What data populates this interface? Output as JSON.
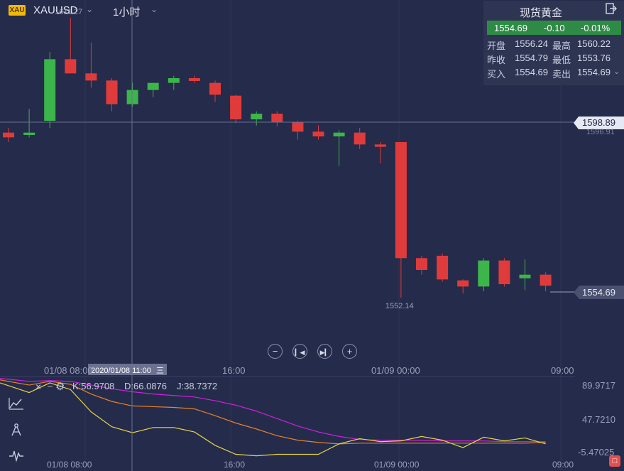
{
  "header": {
    "symbol_badge": "XAU",
    "symbol": "XAUUSD",
    "timeframe": "1小时",
    "chevron": "chevron-down-icon"
  },
  "quote_panel": {
    "title": "现货黄金",
    "last": "1554.69",
    "change": "-0.10",
    "change_pct": "-0.01%",
    "open_label": "开盘",
    "open": "1556.24",
    "high_label": "最高",
    "high": "1560.22",
    "prev_close_label": "昨收",
    "prev_close": "1554.79",
    "low_label": "最低",
    "low": "1553.76",
    "bid_label": "买入",
    "bid": "1554.69",
    "ask_label": "卖出",
    "ask": "1554.69",
    "up_color": "#3cb54a",
    "down_color": "#e03b3b"
  },
  "crosshair": {
    "price": "1598.89",
    "ghost_price": "1596.91",
    "time": "2020/01/08 11:00",
    "menu_glyph": "三"
  },
  "last_price_tag": "1554.69",
  "indicator": {
    "k_label": "K:56.9708",
    "d_label": "D:66.0876",
    "j_label": "J:38.7372",
    "k_color": "#e8822a",
    "d_color": "#d020e0",
    "j_color": "#e8d44a",
    "y_ticks": [
      "89.9717",
      "47.7210",
      "-5.47025"
    ]
  },
  "nav_buttons": [
    "zoom-out",
    "go-start",
    "go-end",
    "zoom-in"
  ],
  "chart_data": [
    {
      "type": "candlestick",
      "title": "XAUUSD 1小时",
      "x_ticks": [
        "01/08 08:00",
        "16:00",
        "01/09 00:00",
        "09:00"
      ],
      "annotations": [
        {
          "text": "1611.27",
          "kind": "max-high"
        },
        {
          "text": "1552.14",
          "kind": "min-low"
        }
      ],
      "candles": [
        {
          "o": 1587.0,
          "h": 1588.0,
          "l": 1585.0,
          "c": 1586.0
        },
        {
          "o": 1586.5,
          "h": 1592.0,
          "l": 1586.0,
          "c": 1587.0
        },
        {
          "o": 1589.5,
          "h": 1604.0,
          "l": 1588.0,
          "c": 1602.5
        },
        {
          "o": 1602.5,
          "h": 1611.27,
          "l": 1601.5,
          "c": 1599.5
        },
        {
          "o": 1599.5,
          "h": 1606.0,
          "l": 1596.5,
          "c": 1598.0
        },
        {
          "o": 1598.0,
          "h": 1598.5,
          "l": 1591.5,
          "c": 1593.0
        },
        {
          "o": 1593.0,
          "h": 1597.5,
          "l": 1592.5,
          "c": 1596.0
        },
        {
          "o": 1596.0,
          "h": 1597.5,
          "l": 1594.5,
          "c": 1597.5
        },
        {
          "o": 1597.5,
          "h": 1599.0,
          "l": 1596.0,
          "c": 1598.5
        },
        {
          "o": 1598.5,
          "h": 1599.0,
          "l": 1597.5,
          "c": 1597.9
        },
        {
          "o": 1597.5,
          "h": 1598.0,
          "l": 1593.5,
          "c": 1595.0
        },
        {
          "o": 1594.8,
          "h": 1595.0,
          "l": 1589.0,
          "c": 1589.8
        },
        {
          "o": 1589.8,
          "h": 1591.5,
          "l": 1588.5,
          "c": 1591.0
        },
        {
          "o": 1591.0,
          "h": 1591.5,
          "l": 1588.3,
          "c": 1589.2
        },
        {
          "o": 1589.2,
          "h": 1589.5,
          "l": 1585.5,
          "c": 1587.2
        },
        {
          "o": 1587.2,
          "h": 1588.5,
          "l": 1585.5,
          "c": 1586.2
        },
        {
          "o": 1586.2,
          "h": 1587.5,
          "l": 1580.0,
          "c": 1587.0
        },
        {
          "o": 1587.0,
          "h": 1588.0,
          "l": 1583.5,
          "c": 1584.5
        },
        {
          "o": 1584.5,
          "h": 1585.0,
          "l": 1580.5,
          "c": 1584.0
        },
        {
          "o": 1585.0,
          "h": 1585.0,
          "l": 1552.14,
          "c": 1560.5
        },
        {
          "o": 1560.5,
          "h": 1561.0,
          "l": 1557.0,
          "c": 1558.0
        },
        {
          "o": 1561.0,
          "h": 1561.5,
          "l": 1555.5,
          "c": 1556.0
        },
        {
          "o": 1555.8,
          "h": 1556.0,
          "l": 1553.0,
          "c": 1554.5
        },
        {
          "o": 1554.5,
          "h": 1560.5,
          "l": 1553.5,
          "c": 1560.0
        },
        {
          "o": 1560.0,
          "h": 1560.5,
          "l": 1554.5,
          "c": 1555.0
        },
        {
          "o": 1556.24,
          "h": 1560.22,
          "l": 1553.76,
          "c": 1557.0
        },
        {
          "o": 1557.0,
          "h": 1557.5,
          "l": 1553.5,
          "c": 1554.69
        }
      ],
      "ylim": [
        1540,
        1615
      ]
    },
    {
      "type": "line",
      "title": "KDJ",
      "series": [
        {
          "name": "K",
          "values": [
            95,
            88,
            93,
            89,
            76,
            66,
            60,
            59,
            58,
            56,
            47,
            37,
            29,
            20,
            14,
            11,
            9,
            10,
            10,
            10,
            10,
            10,
            10,
            10,
            10,
            10,
            11
          ]
        },
        {
          "name": "D",
          "values": [
            97,
            93,
            94,
            93,
            88,
            83,
            79,
            76,
            74,
            72,
            67,
            61,
            53,
            43,
            33,
            25,
            19,
            15,
            14,
            14,
            14,
            13,
            13,
            13,
            12,
            12,
            12
          ]
        },
        {
          "name": "J",
          "values": [
            91,
            78,
            91,
            82,
            52,
            32,
            24,
            31,
            31,
            25,
            7,
            -5,
            -7,
            -5,
            -5,
            -5,
            9,
            16,
            12,
            13,
            19,
            14,
            4,
            18,
            13,
            17,
            9
          ]
        }
      ],
      "ylim": [
        -5.47025,
        89.9717
      ]
    }
  ]
}
